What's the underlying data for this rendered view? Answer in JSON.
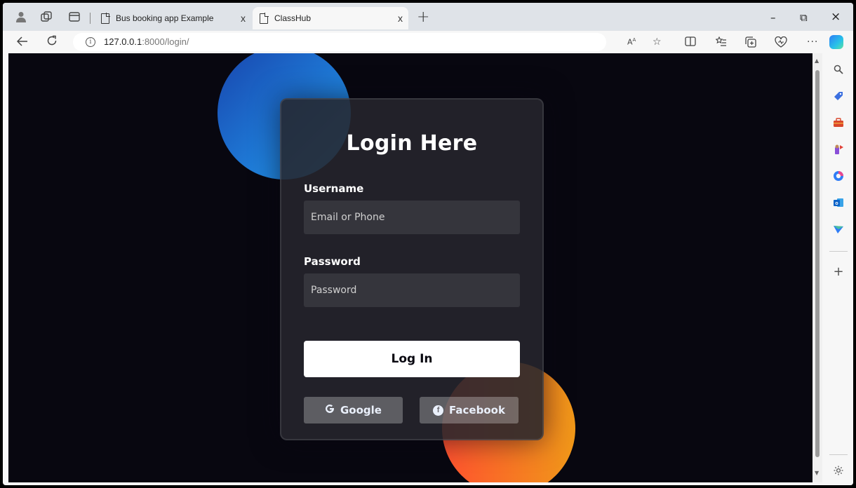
{
  "browser": {
    "tabs": [
      {
        "title": "Bus booking app Example",
        "close": "x"
      },
      {
        "title": "ClassHub",
        "close": "x"
      }
    ],
    "new_tab": "+",
    "window": {
      "minimize": "–",
      "restore": "⧉",
      "close": "×"
    },
    "address": {
      "host": "127.0.0.1",
      "port_path": ":8000/login/"
    }
  },
  "login": {
    "title": "Login Here",
    "username_label": "Username",
    "username_placeholder": "Email or Phone",
    "password_label": "Password",
    "password_placeholder": "Password",
    "submit": "Log In",
    "google": "Google",
    "facebook": "Facebook"
  },
  "colors": {
    "page_bg": "#080710",
    "blob_blue_start": "#1845ad",
    "blob_blue_end": "#23a2f6",
    "blob_orange_start": "#ff512f",
    "blob_orange_end": "#f09819"
  }
}
